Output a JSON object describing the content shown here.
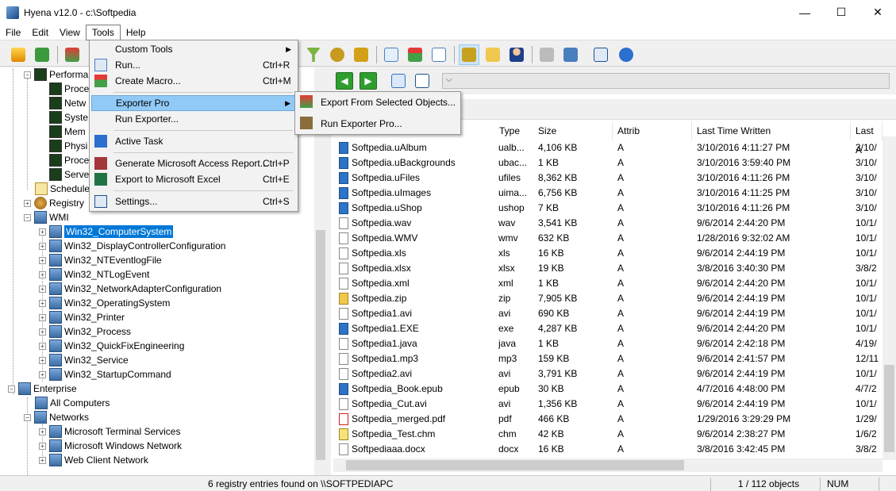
{
  "window": {
    "title": "Hyena v12.0 - c:\\Softpedia",
    "minimize": "—",
    "maximize": "☐",
    "close": "✕"
  },
  "menubar": [
    "File",
    "Edit",
    "View",
    "Tools",
    "Help"
  ],
  "tools_menu": {
    "items": [
      {
        "label": "Custom Tools",
        "shortcut": "",
        "submenu": true
      },
      {
        "label": "Run...",
        "shortcut": "Ctrl+R"
      },
      {
        "label": "Create Macro...",
        "shortcut": "Ctrl+M"
      },
      {
        "label": "Exporter Pro",
        "shortcut": "",
        "submenu": true
      },
      {
        "label": "Run Exporter...",
        "shortcut": ""
      },
      {
        "label": "Active Task",
        "shortcut": ""
      },
      {
        "label": "Generate Microsoft Access Report...",
        "shortcut": "Ctrl+P"
      },
      {
        "label": "Export to Microsoft Excel",
        "shortcut": "Ctrl+E"
      },
      {
        "label": "Settings...",
        "shortcut": "Ctrl+S"
      }
    ]
  },
  "exporter_submenu": [
    "Export From Selected Objects...",
    "Run Exporter Pro..."
  ],
  "tree": {
    "performance_parent": "Performa",
    "performance_children": [
      "Proce",
      "Netw",
      "Syste",
      "Mem",
      "Physi",
      "Proce",
      "Serve"
    ],
    "scheduled": "Schedule",
    "registry": "Registry",
    "wmi": "WMI",
    "wmi_children": [
      "Win32_ComputerSystem",
      "Win32_DisplayControllerConfiguration",
      "Win32_NTEventlogFile",
      "Win32_NTLogEvent",
      "Win32_NetworkAdapterConfiguration",
      "Win32_OperatingSystem",
      "Win32_Printer",
      "Win32_Process",
      "Win32_QuickFixEngineering",
      "Win32_Service",
      "Win32_StartupCommand"
    ],
    "enterprise": "Enterprise",
    "all_computers": "All Computers",
    "networks": "Networks",
    "network_children": [
      "Microsoft Terminal Services",
      "Microsoft Windows Network",
      "Web Client Network"
    ]
  },
  "columns": [
    "Type",
    "Size",
    "Attrib",
    "Last Time Written",
    "Last A"
  ],
  "files": [
    {
      "name": "Softpedia.uAlbum",
      "type": "ualb...",
      "size": "4,106 KB",
      "attrib": "A",
      "written": "3/10/2016 4:11:27 PM",
      "last": "3/10/",
      "icon": "blue"
    },
    {
      "name": "Softpedia.uBackgrounds",
      "type": "ubac...",
      "size": "1 KB",
      "attrib": "A",
      "written": "3/10/2016 3:59:40 PM",
      "last": "3/10/",
      "icon": "blue"
    },
    {
      "name": "Softpedia.uFiles",
      "type": "ufiles",
      "size": "8,362 KB",
      "attrib": "A",
      "written": "3/10/2016 4:11:26 PM",
      "last": "3/10/",
      "icon": "blue"
    },
    {
      "name": "Softpedia.uImages",
      "type": "uima...",
      "size": "6,756 KB",
      "attrib": "A",
      "written": "3/10/2016 4:11:25 PM",
      "last": "3/10/",
      "icon": "blue"
    },
    {
      "name": "Softpedia.uShop",
      "type": "ushop",
      "size": "7 KB",
      "attrib": "A",
      "written": "3/10/2016 4:11:26 PM",
      "last": "3/10/",
      "icon": "blue"
    },
    {
      "name": "Softpedia.wav",
      "type": "wav",
      "size": "3,541 KB",
      "attrib": "A",
      "written": "9/6/2014 2:44:20 PM",
      "last": "10/1/",
      "icon": ""
    },
    {
      "name": "Softpedia.WMV",
      "type": "wmv",
      "size": "632 KB",
      "attrib": "A",
      "written": "1/28/2016 9:32:02 AM",
      "last": "10/1/",
      "icon": ""
    },
    {
      "name": "Softpedia.xls",
      "type": "xls",
      "size": "16 KB",
      "attrib": "A",
      "written": "9/6/2014 2:44:19 PM",
      "last": "10/1/",
      "icon": ""
    },
    {
      "name": "Softpedia.xlsx",
      "type": "xlsx",
      "size": "19 KB",
      "attrib": "A",
      "written": "3/8/2016 3:40:30 PM",
      "last": "3/8/2",
      "icon": ""
    },
    {
      "name": "Softpedia.xml",
      "type": "xml",
      "size": "1 KB",
      "attrib": "A",
      "written": "9/6/2014 2:44:20 PM",
      "last": "10/1/",
      "icon": ""
    },
    {
      "name": "Softpedia.zip",
      "type": "zip",
      "size": "7,905 KB",
      "attrib": "A",
      "written": "9/6/2014 2:44:19 PM",
      "last": "10/1/",
      "icon": "zip"
    },
    {
      "name": "Softpedia1.avi",
      "type": "avi",
      "size": "690 KB",
      "attrib": "A",
      "written": "9/6/2014 2:44:19 PM",
      "last": "10/1/",
      "icon": ""
    },
    {
      "name": "Softpedia1.EXE",
      "type": "exe",
      "size": "4,287 KB",
      "attrib": "A",
      "written": "9/6/2014 2:44:20 PM",
      "last": "10/1/",
      "icon": "blue"
    },
    {
      "name": "Softpedia1.java",
      "type": "java",
      "size": "1 KB",
      "attrib": "A",
      "written": "9/6/2014 2:42:18 PM",
      "last": "4/19/",
      "icon": ""
    },
    {
      "name": "Softpedia1.mp3",
      "type": "mp3",
      "size": "159 KB",
      "attrib": "A",
      "written": "9/6/2014 2:41:57 PM",
      "last": "12/11",
      "icon": ""
    },
    {
      "name": "Softpedia2.avi",
      "type": "avi",
      "size": "3,791 KB",
      "attrib": "A",
      "written": "9/6/2014 2:44:19 PM",
      "last": "10/1/",
      "icon": ""
    },
    {
      "name": "Softpedia_Book.epub",
      "type": "epub",
      "size": "30 KB",
      "attrib": "A",
      "written": "4/7/2016 4:48:00 PM",
      "last": "4/7/2",
      "icon": "blue"
    },
    {
      "name": "Softpedia_Cut.avi",
      "type": "avi",
      "size": "1,356 KB",
      "attrib": "A",
      "written": "9/6/2014 2:44:19 PM",
      "last": "10/1/",
      "icon": ""
    },
    {
      "name": "Softpedia_merged.pdf",
      "type": "pdf",
      "size": "466 KB",
      "attrib": "A",
      "written": "1/29/2016 3:29:29 PM",
      "last": "1/29/",
      "icon": "pdf"
    },
    {
      "name": "Softpedia_Test.chm",
      "type": "chm",
      "size": "42 KB",
      "attrib": "A",
      "written": "9/6/2014 2:38:27 PM",
      "last": "1/6/2",
      "icon": "chm"
    },
    {
      "name": "Softpediaaa.docx",
      "type": "docx",
      "size": "16 KB",
      "attrib": "A",
      "written": "3/8/2016 3:42:45 PM",
      "last": "3/8/2",
      "icon": ""
    }
  ],
  "status": {
    "left": "6 registry entries found on \\\\SOFTPEDIAPC",
    "objects": "1 / 112 objects",
    "num": "NUM"
  }
}
